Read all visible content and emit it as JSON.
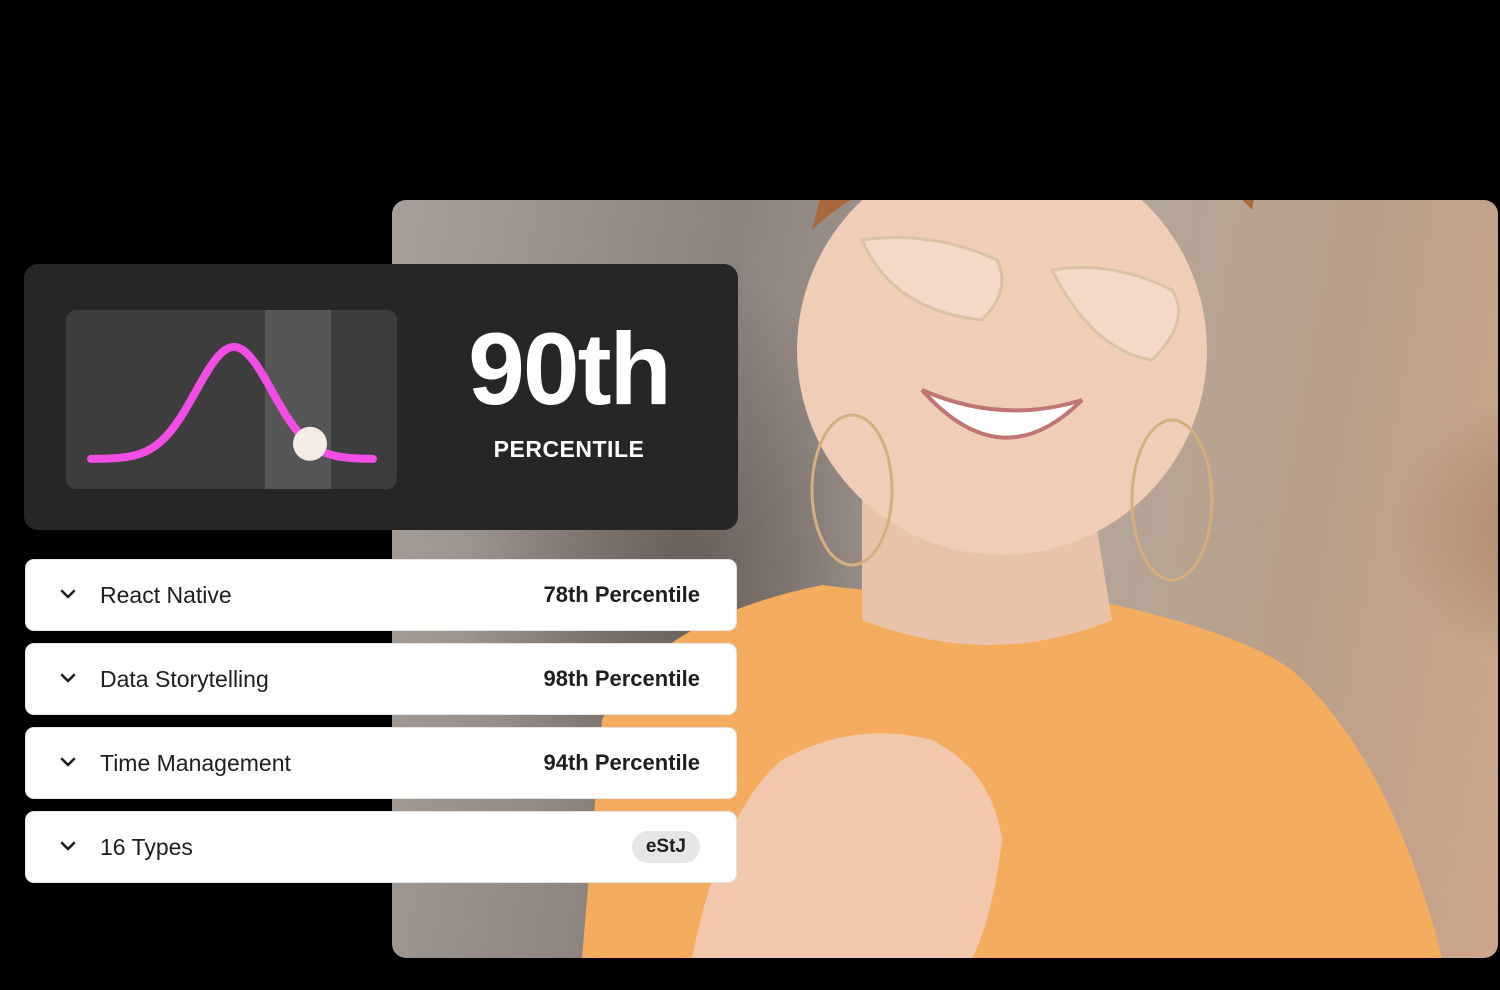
{
  "hero": {
    "photo_subject": "smiling-person-photo"
  },
  "score_card": {
    "value": "90th",
    "label": "PERCENTILE",
    "percentile": 90,
    "curve_color": "#f24ee6"
  },
  "skills": [
    {
      "name": "React Native",
      "value": "78th Percentile"
    },
    {
      "name": "Data Storytelling",
      "value": "98th Percentile"
    },
    {
      "name": "Time Management",
      "value": "94th Percentile"
    },
    {
      "name": "16 Types",
      "badge": "eStJ"
    }
  ],
  "icons": {
    "row_toggle": "chevron-down-icon"
  }
}
